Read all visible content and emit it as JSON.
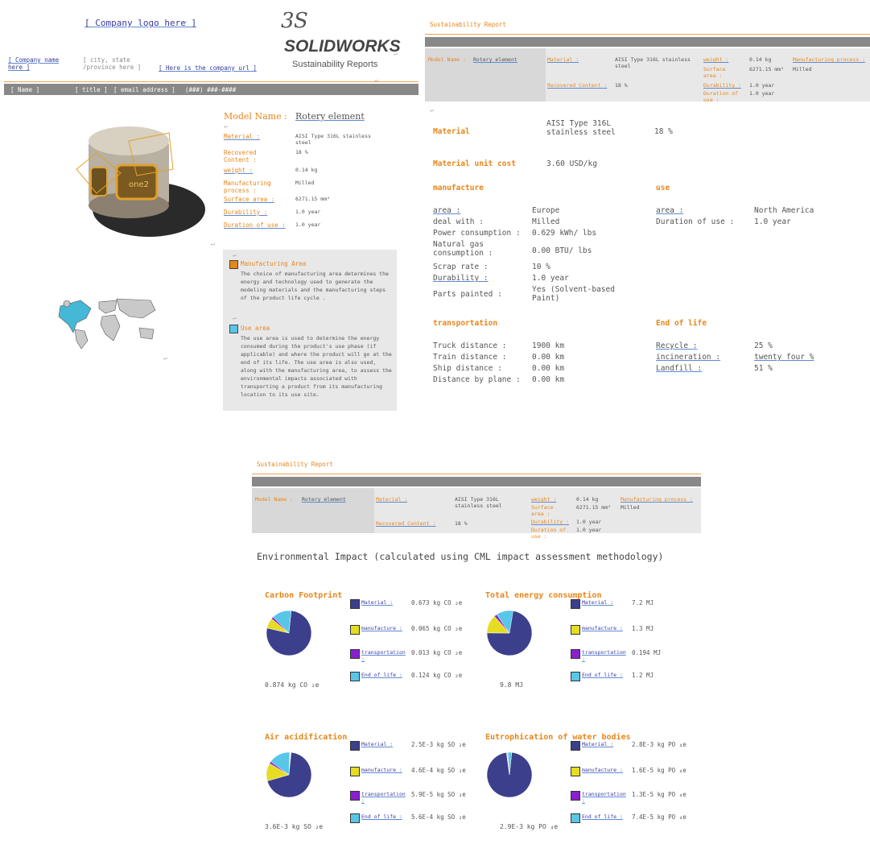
{
  "p1": {
    "company_logo": "[ Company logo here ]",
    "brand_name": "SOLIDWORKS",
    "brand_sub": "Sustainability Reports",
    "company_name": "[ Company name here ]",
    "city": "[ city, state /province here ]",
    "company_url": "[ Here is the company url ]",
    "name": "[ Name ]",
    "title": "[ title ]",
    "email": "[ email address ]",
    "phone": "(###) ###-####",
    "model_name_label": "Model Name :",
    "model_name_value": "Rotery element",
    "fields": [
      {
        "label": "Material :",
        "value": "AISI Type 316L stainless steel"
      },
      {
        "label": "Recovered Content :",
        "value": "18 %"
      },
      {
        "label": "weight :",
        "value": "0.14 kg"
      },
      {
        "label": "Manufacturing process :",
        "value": "Milled"
      },
      {
        "label": "Surface area :",
        "value": "6271.15 mm²"
      },
      {
        "label": "Durability :",
        "value": "1.0 year"
      },
      {
        "label": "Duration of use :",
        "value": "1.0 year"
      }
    ],
    "mfg_area_title": "Manufacturing Area",
    "mfg_area_text": "The choice of manufacturing area determines the energy and technology used to generate the modeling materials and the manufacturing steps of the product life cycle .",
    "use_area_title": "Use area",
    "use_area_text": "The use area is used to determine the energy consumed during the product's use phase (if applicable) and where the product will go at the end of its life. The use area is also used, along with the manufacturing area, to assess the environmental impacts associated with transporting a product from its manufacturing location to its use site."
  },
  "header": {
    "report_title": "Sustainability Report",
    "model_name_label": "Model Name :",
    "model_name_value": "Rotery element",
    "material_label": "Material :",
    "material_value": "AISI Type 316L stainless steel",
    "recovered_label": "Recovered Content :",
    "recovered_value": "18 %",
    "weight_label": "weight :",
    "weight_value": "0.14 kg",
    "surface_label": "Surface area :",
    "surface_value": "6271.15 mm²",
    "durability_label": "Durability :",
    "durability_value": "1.0 year",
    "duration_label": "Duration of use :",
    "duration_value": "1.0 year",
    "mfg_label": "Manufacturing process :",
    "mfg_value": "Milled"
  },
  "p2": {
    "material_label": "Material",
    "material_value": "AISI Type 316L stainless steel",
    "recovered_value": "18 %",
    "unit_cost_label": "Material unit cost",
    "unit_cost_value": "3.60 USD/kg",
    "manufacture_title": "manufacture",
    "manufacture_rows": [
      {
        "label": "area :",
        "value": "Europe"
      },
      {
        "label": "deal with :",
        "value": "Milled"
      },
      {
        "label": "Power consumption :",
        "value": "0.629 kWh/ lbs"
      },
      {
        "label": "Natural gas consumption :",
        "value": "0.00 BTU/ lbs"
      },
      {
        "label": "Scrap rate :",
        "value": "10 %"
      },
      {
        "label": "Durability :",
        "value": "1.0 year"
      },
      {
        "label": "Parts painted :",
        "value": "Yes (Solvent-based Paint)"
      }
    ],
    "use_title": "use",
    "use_rows": [
      {
        "label": "area :",
        "value": "North America"
      },
      {
        "label": "Duration of use :",
        "value": "1.0 year"
      }
    ],
    "transport_title": "transportation",
    "transport_rows": [
      {
        "label": "Truck distance :",
        "value": "1900 km"
      },
      {
        "label": "Train distance :",
        "value": "0.00 km"
      },
      {
        "label": "Ship distance :",
        "value": "0.00 km"
      },
      {
        "label": "Distance by plane :",
        "value": "0.00 km"
      }
    ],
    "eol_title": "End of life",
    "eol_rows": [
      {
        "label": "Recycle :",
        "value": "25 %"
      },
      {
        "label": "incineration :",
        "value": "twenty four %"
      },
      {
        "label": "Landfill :",
        "value": "51 %"
      }
    ]
  },
  "p3": {
    "env_title": "Environmental Impact (calculated using CML impact assessment methodology)",
    "legend_labels": [
      "Material :",
      "manufacture :",
      "transportation :",
      "End of life :"
    ],
    "legend_colors": [
      "#3b3f8c",
      "#e6dc22",
      "#8a1fd0",
      "#59c6e8"
    ],
    "panels": [
      {
        "title": "Carbon Footprint",
        "total": "0.874 kg CO ₂e",
        "values": [
          "0.673 kg CO ₂e",
          "0.065 kg CO ₂e",
          "0.013 kg CO ₂e",
          "0.124 kg CO ₂e"
        ]
      },
      {
        "title": "Total energy consumption",
        "total": "9.8 MJ",
        "values": [
          "7.2 MJ",
          "1.3 MJ",
          "0.194 MJ",
          "1.2 MJ"
        ]
      },
      {
        "title": "Air acidification",
        "total": "3.6E-3 kg SO ₂e",
        "values": [
          "2.5E-3 kg SO ₂e",
          "4.6E-4 kg SO ₂e",
          "5.9E-5 kg SO ₂e",
          "5.6E-4 kg SO ₂e"
        ]
      },
      {
        "title": "Eutrophication of water bodies",
        "total": "2.9E-3 kg PO ₄e",
        "values": [
          "2.8E-3 kg PO ₄e",
          "1.6E-5 kg PO ₄e",
          "1.3E-5 kg PO ₄e",
          "7.4E-5 kg PO ₄e"
        ]
      }
    ],
    "pie_fractions": [
      [
        0.77,
        0.074,
        0.015,
        0.141
      ],
      [
        0.735,
        0.133,
        0.02,
        0.122
      ],
      [
        0.69,
        0.128,
        0.016,
        0.156
      ],
      [
        0.963,
        0.006,
        0.004,
        0.027
      ]
    ]
  }
}
